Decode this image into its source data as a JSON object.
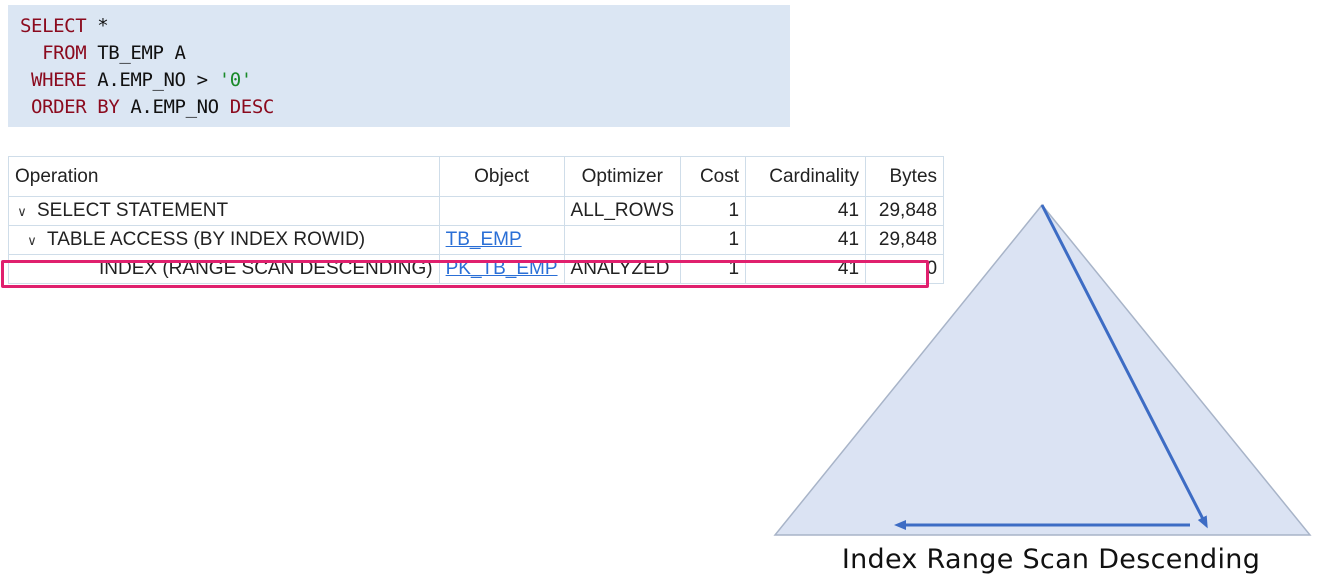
{
  "sql": {
    "line1": {
      "kw": "SELECT",
      "rest": " *"
    },
    "line2": {
      "kw": "FROM",
      "rest": " TB_EMP A"
    },
    "line3": {
      "kw": "WHERE",
      "rest": " A.EMP_NO > ",
      "str": "'0'"
    },
    "line4": {
      "kw1": "ORDER BY",
      "rest": " A.EMP_NO ",
      "kw2": "DESC"
    }
  },
  "plan": {
    "headers": {
      "operation": "Operation",
      "object": "Object",
      "optimizer": "Optimizer",
      "cost": "Cost",
      "cardinality": "Cardinality",
      "bytes": "Bytes"
    },
    "rows": [
      {
        "operation": "SELECT STATEMENT",
        "object": "",
        "optimizer": "ALL_ROWS",
        "cost": "1",
        "cardinality": "41",
        "bytes": "29,848"
      },
      {
        "operation": "TABLE ACCESS (BY INDEX ROWID)",
        "object": "TB_EMP",
        "optimizer": "",
        "cost": "1",
        "cardinality": "41",
        "bytes": "29,848"
      },
      {
        "operation": "INDEX (RANGE SCAN DESCENDING)",
        "object": "PK_TB_EMP",
        "optimizer": "ANALYZED",
        "cost": "1",
        "cardinality": "41",
        "bytes": "0"
      }
    ]
  },
  "diagram": {
    "caption": "Index Range Scan Descending",
    "colors": {
      "fill": "#dbe3f3",
      "stroke": "#a8b4c8",
      "arrow": "#3d6cc4"
    }
  },
  "colors": {
    "highlight": "#e0206e",
    "link": "#2a6fd6",
    "keyword": "#8b0a1e",
    "string": "#1a8a2a"
  }
}
